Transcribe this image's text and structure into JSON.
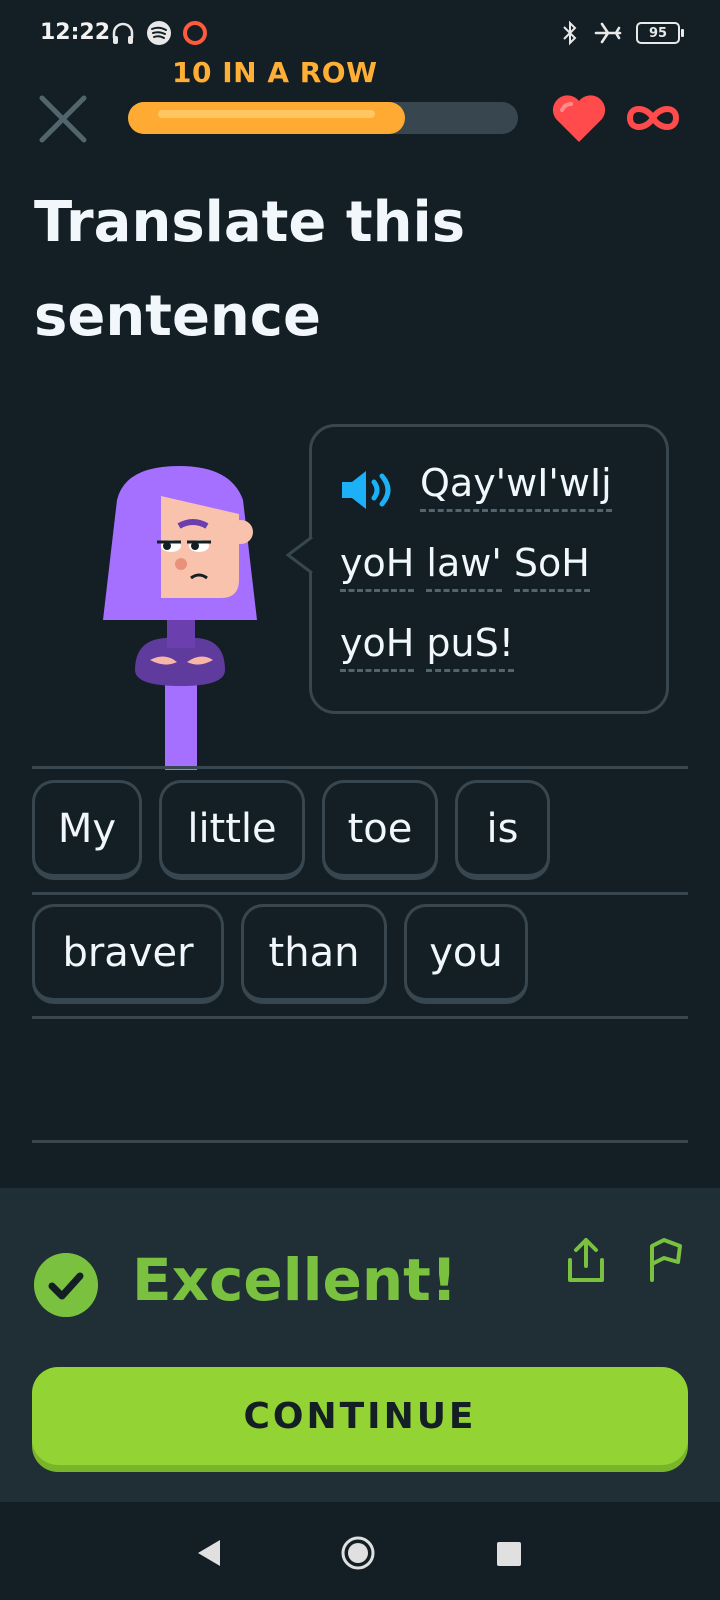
{
  "status_bar": {
    "time": "12:22",
    "battery": "95",
    "icons_left": [
      "headphones-icon",
      "spotify-icon",
      "record-ring-icon"
    ],
    "icons_right": [
      "bluetooth-icon",
      "airplane-mode-icon",
      "battery-icon"
    ]
  },
  "header": {
    "streak_text": "10 IN A ROW",
    "progress_fraction": 0.71,
    "hearts": "infinite",
    "colors": {
      "streak": "#ffaf36",
      "progress": "#ffab33",
      "heart": "#ff4b4b"
    }
  },
  "prompt": {
    "title": "Translate this sentence",
    "sentence_lines": [
      [
        "Qay'wI'wIj"
      ],
      [
        "yoH",
        "law'",
        "SoH"
      ],
      [
        "yoH",
        "puS!"
      ]
    ]
  },
  "answer": {
    "row1": [
      "My",
      "little",
      "toe",
      "is"
    ],
    "row2": [
      "braver",
      "than",
      "you"
    ]
  },
  "feedback": {
    "message": "Excellent!",
    "button_label": "CONTINUE",
    "colors": {
      "success": "#79c13f",
      "button": "#93d333"
    }
  }
}
